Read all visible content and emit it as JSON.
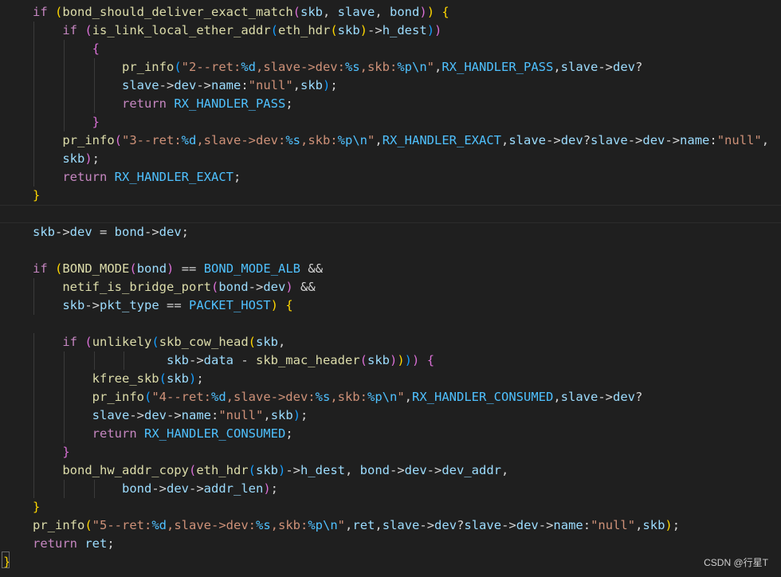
{
  "editor": {
    "theme": "dark",
    "colors": {
      "background": "#1f1f1f",
      "keyword": "#569cd6",
      "function": "#dcdcaa",
      "variable": "#9cdcfe",
      "string": "#ce9178",
      "macro": "#4fc1ff",
      "bracket_level1": "#ffd700",
      "bracket_level2": "#da70d6",
      "bracket_level3": "#179fff"
    },
    "lines": [
      "if (bond_should_deliver_exact_match(skb, slave, bond)) {",
      "    if (is_link_local_ether_addr(eth_hdr(skb)->h_dest))",
      "        {",
      "            pr_info(\"2--ret:%d,slave->dev:%s,skb:%p\\n\",RX_HANDLER_PASS,slave->dev?",
      "            slave->dev->name:\"null\",skb);",
      "            return RX_HANDLER_PASS;",
      "        }",
      "    pr_info(\"3--ret:%d,slave->dev:%s,skb:%p\\n\",RX_HANDLER_EXACT,slave->dev?slave->dev->name:\"null\",",
      "    skb);",
      "    return RX_HANDLER_EXACT;",
      "}",
      "",
      "skb->dev = bond->dev;",
      "",
      "if (BOND_MODE(bond) == BOND_MODE_ALB &&",
      "    netif_is_bridge_port(bond->dev) &&",
      "    skb->pkt_type == PACKET_HOST) {",
      "",
      "    if (unlikely(skb_cow_head(skb,",
      "                  skb->data - skb_mac_header(skb)))) {",
      "        kfree_skb(skb);",
      "        pr_info(\"4--ret:%d,slave->dev:%s,skb:%p\\n\",RX_HANDLER_CONSUMED,slave->dev?",
      "        slave->dev->name:\"null\",skb);",
      "        return RX_HANDLER_CONSUMED;",
      "    }",
      "    bond_hw_addr_copy(eth_hdr(skb)->h_dest, bond->dev->dev_addr,",
      "            bond->dev->addr_len);",
      "}",
      "pr_info(\"5--ret:%d,slave->dev:%s,skb:%p\\n\",ret,slave->dev?slave->dev->name:\"null\",skb);",
      "return ret;",
      "}"
    ]
  },
  "watermark": "CSDN @行星T"
}
